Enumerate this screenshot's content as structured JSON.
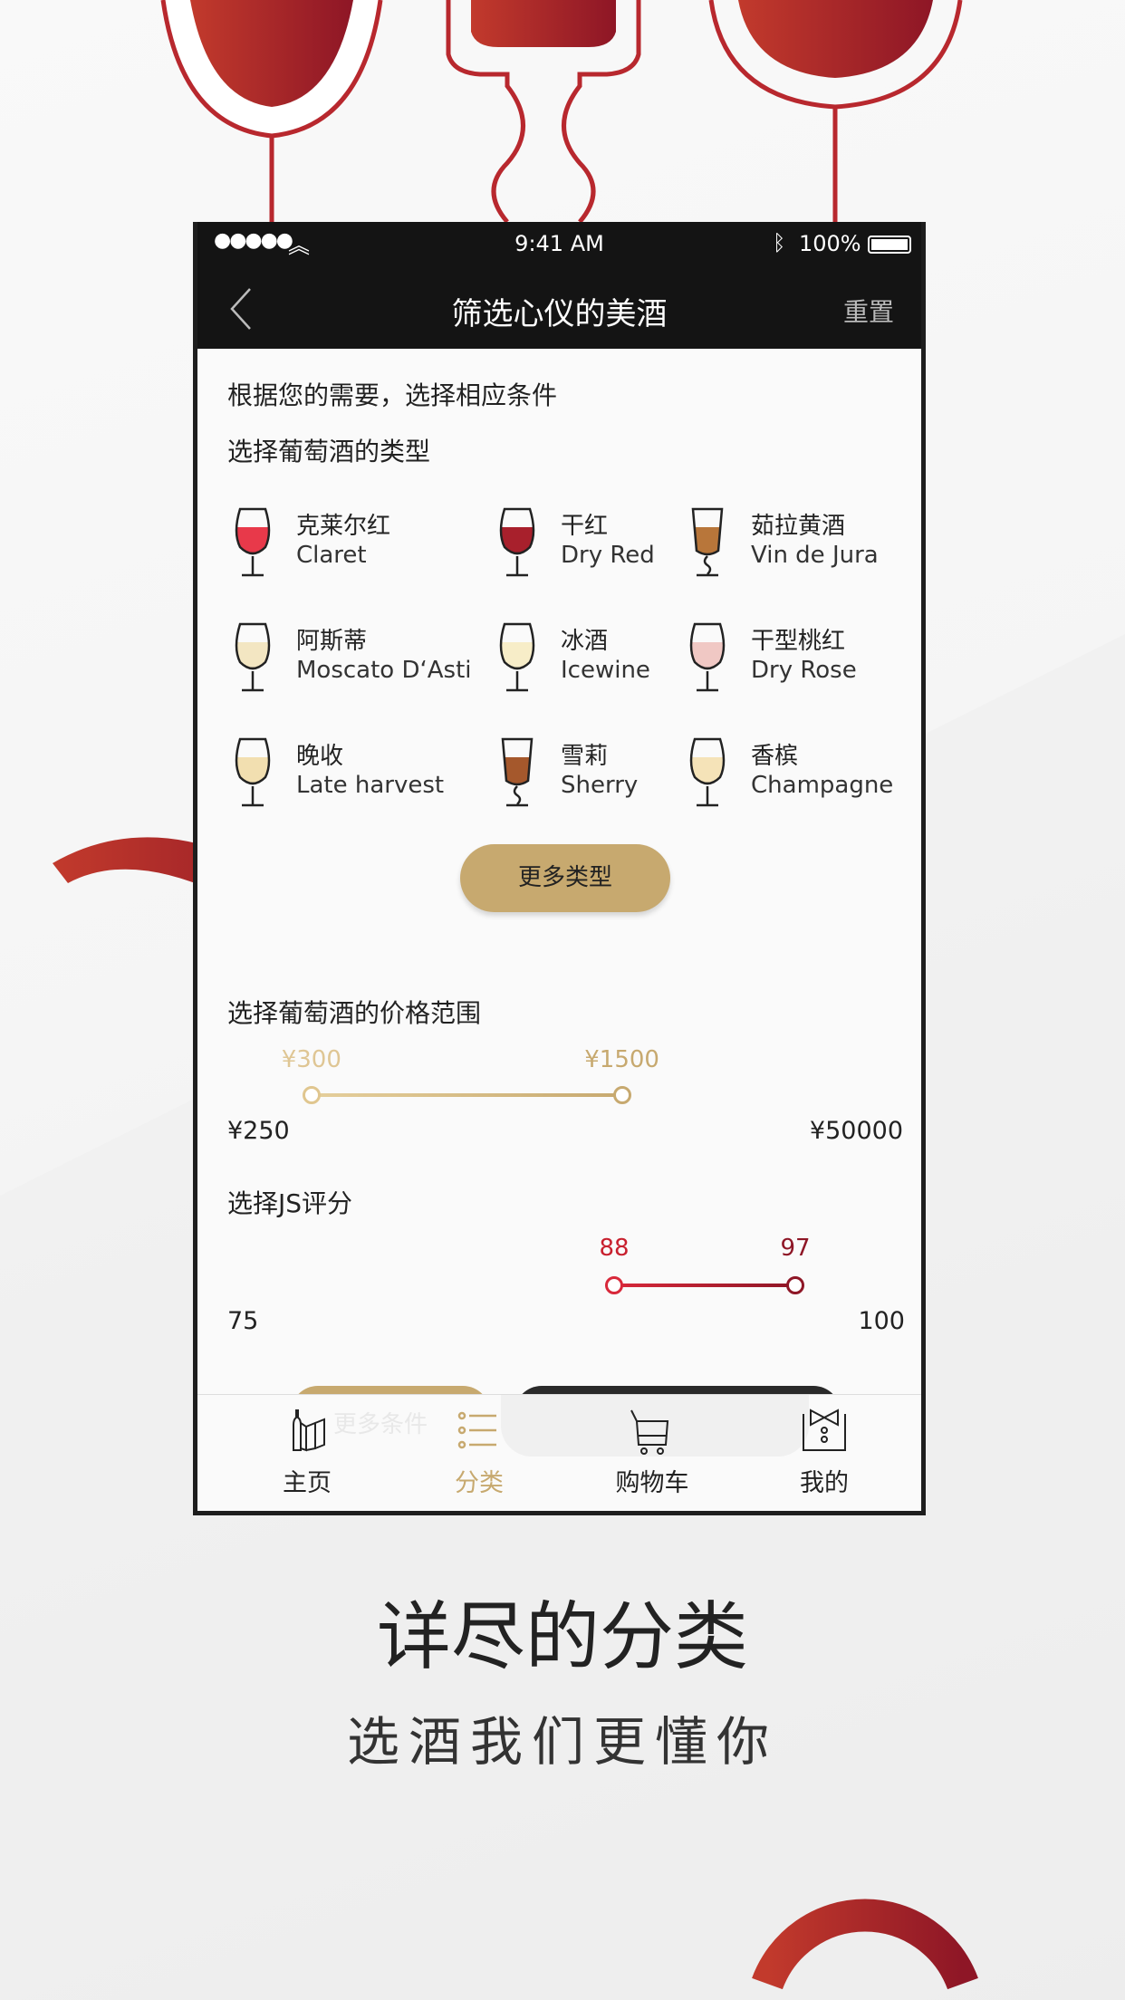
{
  "status_bar": {
    "time": "9:41 AM",
    "battery": "100%",
    "icons": [
      "signal-dots-icon",
      "wifi-icon",
      "bluetooth-icon",
      "battery-icon"
    ]
  },
  "nav": {
    "title": "筛选心仪的美酒",
    "reset": "重置",
    "back_icon": "chevron-left-icon"
  },
  "intro": "根据您的需要，选择相应条件",
  "type_section": {
    "title": "选择葡萄酒的类型",
    "items": [
      {
        "cn": "克莱尔红",
        "en": "Claret",
        "color": "#e8394a"
      },
      {
        "cn": "干红",
        "en": "Dry Red",
        "color": "#a8202c"
      },
      {
        "cn": "茹拉黄酒",
        "en": "Vin de Jura",
        "color": "#b8763a"
      },
      {
        "cn": "阿斯蒂",
        "en": "Moscato D‘Asti",
        "color": "#f3e6c2"
      },
      {
        "cn": "冰酒",
        "en": "Icewine",
        "color": "#f7edc8"
      },
      {
        "cn": "干型桃红",
        "en": "Dry Rose",
        "color": "#f0c8c4"
      },
      {
        "cn": "晚收",
        "en": "Late harvest",
        "color": "#f2dfb0"
      },
      {
        "cn": "雪莉",
        "en": "Sherry",
        "color": "#a5582c"
      },
      {
        "cn": "香槟",
        "en": "Champagne",
        "color": "#f5e3b8"
      }
    ],
    "more_button": "更多类型"
  },
  "price_section": {
    "title": "选择葡萄酒的价格范围",
    "min_label": "¥250",
    "max_label": "¥50000",
    "low_value": "¥300",
    "high_value": "¥1500",
    "min": 250,
    "max": 50000,
    "low": 300,
    "high": 1500,
    "color": "#c7a96f"
  },
  "score_section": {
    "title": "选择JS评分",
    "min_label": "75",
    "max_label": "100",
    "low_value": "88",
    "high_value": "97",
    "min": 75,
    "max": 100,
    "low": 88,
    "high": 97,
    "color": "#c8202e"
  },
  "hidden_button": "更多条件",
  "tabbar": {
    "items": [
      {
        "label": "主页",
        "icon": "wine-menu-icon"
      },
      {
        "label": "分类",
        "icon": "list-icon",
        "active": true
      },
      {
        "label": "购物车",
        "icon": "cart-icon"
      },
      {
        "label": "我的",
        "icon": "tuxedo-icon"
      }
    ],
    "active_color": "#c7a96f"
  },
  "headline": "详尽的分类",
  "subheadline": "选酒我们更懂你"
}
